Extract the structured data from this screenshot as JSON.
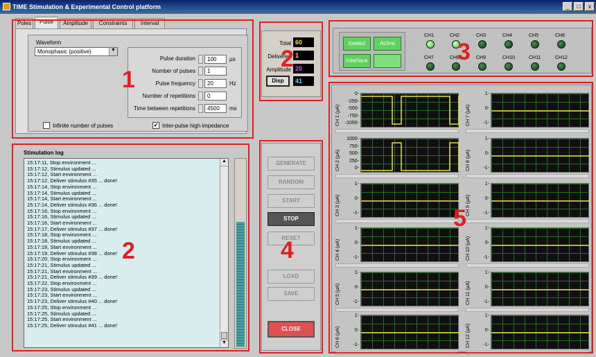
{
  "window": {
    "title": "TIME Stimulation & Experimental Control platform",
    "buttons": [
      "_",
      "□",
      "x"
    ]
  },
  "annotations": [
    "1",
    "2",
    "3",
    "2",
    "4",
    "5"
  ],
  "tabs": [
    "Poles",
    "Pulse",
    "Amplitude",
    "Constraints",
    "Interval"
  ],
  "pulse": {
    "waveform_label": "Waveform",
    "waveform_value": "Monophasic (positive)",
    "fields": [
      {
        "label": "Pulse duration",
        "value": "100",
        "unit": "µs"
      },
      {
        "label": "Number of pulses",
        "value": "1",
        "unit": ""
      },
      {
        "label": "Pulse frequency",
        "value": "20",
        "unit": "Hz"
      },
      {
        "label": "Number of repetitions",
        "value": "0",
        "unit": ""
      },
      {
        "label": "Time between repetitions",
        "value": "4500",
        "unit": "ms"
      }
    ],
    "infinite_label": "Infinite number of pulses",
    "infinite_checked": false,
    "impedance_label": "Inter-pulse high impedance",
    "impedance_checked": true
  },
  "counters": {
    "total_label": "Total",
    "total": "60",
    "delivered_label": "Delivered",
    "delivered": "1",
    "amplitude_label": "Amplitude",
    "amplitude": "20",
    "disp_label": "Disp",
    "disp": "41"
  },
  "log": {
    "title": "Stimulation log",
    "lines": [
      "15:17:11,  Stop environment ...",
      "15:17:12,  Stimulus updated ...",
      "15:17:12,  Start environment ...",
      "15:17:12,  Deliver stimulus #35 ... done!",
      "15:17:14,  Stop environment ...",
      "15:17:14,  Stimulus updated ...",
      "15:17:14,  Start environment ...",
      "15:17:14,  Deliver stimulus #36 ... done!",
      "15:17:16,  Stop environment ...",
      "15:17:16,  Stimulus updated ...",
      "15:17:16,  Start environment ...",
      "15:17:17,  Deliver stimulus #37 ... done!",
      "15:17:18,  Stop environment ...",
      "15:17:18,  Stimulus updated ...",
      "15:17:18,  Start environment ...",
      "15:17:19,  Deliver stimulus #38 ... done!",
      "15:17:20,  Stop environment ...",
      "15:17:21,  Stimulus updated ...",
      "15:17:21,  Start environment ...",
      "15:17:21,  Deliver stimulus #39 ... done!",
      "15:17:22,  Stop environment ...",
      "15:17:23,  Stimulus updated ...",
      "15:17:23,  Start environment ...",
      "15:17:23,  Deliver stimulus #40 ... done!",
      "15:17:25,  Stop environment ...",
      "15:17:25,  Stimulus updated ...",
      "15:17:25,  Start environment ...",
      "15:17:25,  Deliver stimulus #41 ... done!"
    ]
  },
  "control_buttons": [
    "GENERATE",
    "RANDOM",
    "START",
    "STOP",
    "RESET",
    "LOAD",
    "SAVE",
    "CLOSE"
  ],
  "status": {
    "loaded": "loaded",
    "active": "Active",
    "interface": "Interface"
  },
  "channels": [
    "CH1",
    "CH2",
    "CH3",
    "CH4",
    "CH5",
    "CH6",
    "CH7",
    "CH8",
    "CH9",
    "CH10",
    "CH11",
    "CH12"
  ],
  "channels_on": [
    true,
    true,
    false,
    false,
    false,
    false,
    false,
    false,
    false,
    false,
    false,
    false
  ],
  "plots": [
    {
      "label": "CH 1 (µA)",
      "ticks": [
        "0-",
        "-250-",
        "-500-",
        "-750-",
        "-1000-"
      ]
    },
    {
      "label": "CH 7 (µA)",
      "ticks": [
        "1-",
        "0-",
        "-1-"
      ]
    },
    {
      "label": "CH 2 (µA)",
      "ticks": [
        "1000-",
        "750-",
        "500-",
        "250-",
        "0-"
      ]
    },
    {
      "label": "CH 8 (µA)",
      "ticks": [
        "1-",
        "0-",
        "-1-"
      ]
    },
    {
      "label": "CH 3 (µA)",
      "ticks": [
        "1-",
        "0-",
        "-1-"
      ]
    },
    {
      "label": "CH 9 (µA)",
      "ticks": [
        "1-",
        "0-",
        "-1-"
      ]
    },
    {
      "label": "CH 4 (µA)",
      "ticks": [
        "1-",
        "0-",
        "-1-"
      ]
    },
    {
      "label": "CH 10 (µA)",
      "ticks": [
        "1-",
        "0-",
        "-1-"
      ]
    },
    {
      "label": "CH 5 (µA)",
      "ticks": [
        "1-",
        "0-",
        "-1-"
      ]
    },
    {
      "label": "CH 11 (µA)",
      "ticks": [
        "1-",
        "0-",
        "-1-"
      ]
    },
    {
      "label": "CH 6 (µA)",
      "ticks": [
        "1-",
        "0-",
        "-1-"
      ]
    },
    {
      "label": "CH 12 (µA)",
      "ticks": [
        "1-",
        "0-",
        "-1-"
      ]
    }
  ],
  "colors": {
    "trace": "#e8e04a",
    "plot_bg": "#101010",
    "grid": "#2a6a2a",
    "annotation": "#e02020",
    "led_on": "#3fbf3f",
    "log_bg": "#d8eeee"
  }
}
